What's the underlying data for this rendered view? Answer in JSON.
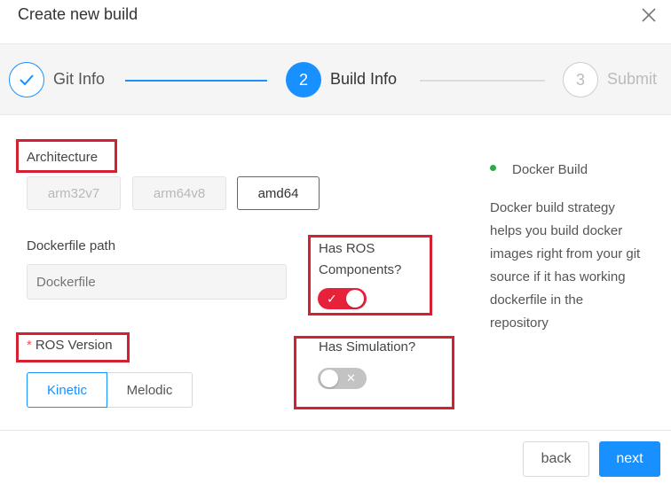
{
  "dialog": {
    "title": "Create new build",
    "close_icon": "close-icon"
  },
  "steps": [
    {
      "label": "Git Info",
      "marker": "✓",
      "status": "done"
    },
    {
      "label": "Build Info",
      "marker": "2",
      "status": "active"
    },
    {
      "label": "Submit",
      "marker": "3",
      "status": "pending"
    }
  ],
  "architecture": {
    "label": "Architecture",
    "options": [
      {
        "label": "arm32v7",
        "state": "disabled"
      },
      {
        "label": "arm64v8",
        "state": "disabled"
      },
      {
        "label": "amd64",
        "state": "selected"
      }
    ]
  },
  "dockerfile": {
    "label": "Dockerfile path",
    "placeholder": "Dockerfile",
    "value": ""
  },
  "has_ros": {
    "label_line1": "Has ROS",
    "label_line2": "Components?",
    "on": true,
    "on_mark": "✓"
  },
  "ros_version": {
    "required_mark": "*",
    "label": "ROS Version",
    "options": [
      {
        "label": "Kinetic",
        "selected": true
      },
      {
        "label": "Melodic",
        "selected": false
      }
    ]
  },
  "has_simulation": {
    "label": "Has Simulation?",
    "on": false,
    "off_mark": "✕"
  },
  "sidebar": {
    "title": "Docker Build",
    "status_color": "#2ea84b",
    "description": "Docker build strategy helps you build docker images right from your git source if it has working dockerfile in the repository"
  },
  "footer": {
    "back_label": "back",
    "next_label": "next"
  },
  "colors": {
    "primary": "#1890ff",
    "toggle_on": "#e8213a",
    "highlight_box": "#d42030"
  }
}
